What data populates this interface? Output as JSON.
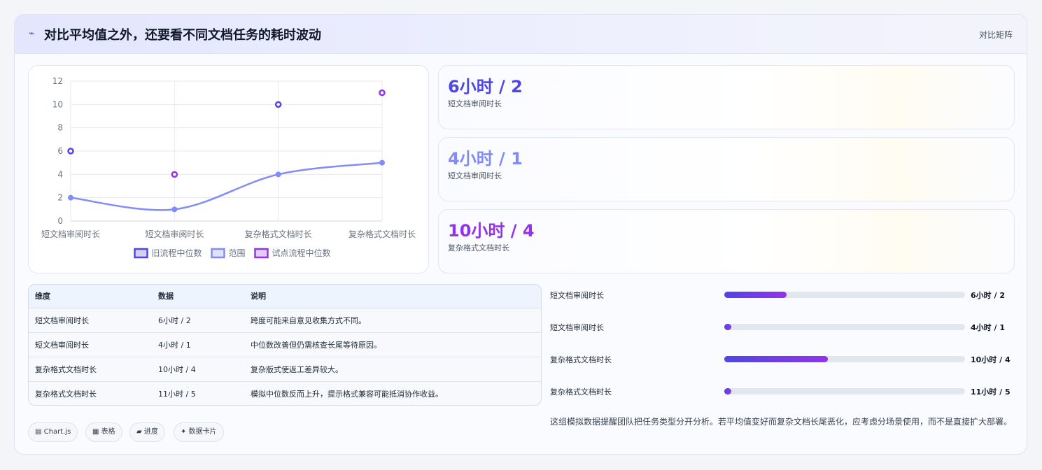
{
  "header": {
    "icon": "trend-icon",
    "title": "对比平均值之外，还要看不同文档任务的耗时波动",
    "tag": "对比矩阵"
  },
  "colors": {
    "old_flow": "#4f46e5",
    "range": "#818cf8",
    "pilot_flow": "#9333ea"
  },
  "chart_data": {
    "type": "line",
    "categories": [
      "短文档审阅时长",
      "短文档审阅时长",
      "复杂格式文档时长",
      "复杂格式文档时长"
    ],
    "ylim": [
      0,
      12
    ],
    "yticks": [
      "0",
      "2",
      "4",
      "6",
      "8",
      "10",
      "12"
    ],
    "grid": true,
    "legend_position": "bottom",
    "series": [
      {
        "name": "旧流程中位数",
        "type": "scatter",
        "color": "#4f46e5",
        "values": [
          6,
          null,
          10,
          null
        ]
      },
      {
        "name": "范围",
        "type": "line",
        "color": "#818cf8",
        "values": [
          2,
          1,
          4,
          5
        ]
      },
      {
        "name": "试点流程中位数",
        "type": "scatter",
        "color": "#9333ea",
        "values": [
          null,
          4,
          null,
          11
        ]
      }
    ]
  },
  "stats": [
    {
      "value": "6小时 / 2",
      "label": "短文档审阅时长",
      "color": "#4f46e5"
    },
    {
      "value": "4小时 / 1",
      "label": "短文档审阅时长",
      "color": "#818cf8"
    },
    {
      "value": "10小时 / 4",
      "label": "复杂格式文档时长",
      "color": "#9333ea"
    }
  ],
  "table": {
    "headers": [
      "维度",
      "数据",
      "说明"
    ],
    "rows": [
      [
        "短文档审阅时长",
        "6小时 / 2",
        "跨度可能来自意见收集方式不同。"
      ],
      [
        "短文档审阅时长",
        "4小时 / 1",
        "中位数改善但仍需核查长尾等待原因。"
      ],
      [
        "复杂格式文档时长",
        "10小时 / 4",
        "复杂版式使返工差异较大。"
      ],
      [
        "复杂格式文档时长",
        "11小时 / 5",
        "模拟中位数反而上升，提示格式兼容可能抵消协作收益。"
      ]
    ]
  },
  "chips": [
    "▤ Chart.js",
    "▦ 表格",
    "▰ 进度",
    "✦ 数据卡片"
  ],
  "progress": [
    {
      "label": "短文档审阅时长",
      "value": "6小时 / 2",
      "fraction": 0.26
    },
    {
      "label": "短文档审阅时长",
      "value": "4小时 / 1",
      "fraction": 0.03
    },
    {
      "label": "复杂格式文档时长",
      "value": "10小时 / 4",
      "fraction": 0.43
    },
    {
      "label": "复杂格式文档时长",
      "value": "11小时 / 5",
      "fraction": 0.03
    }
  ],
  "note": "这组模拟数据提醒团队把任务类型分开分析。若平均值变好而复杂文档长尾恶化，应考虑分场景使用，而不是直接扩大部署。"
}
